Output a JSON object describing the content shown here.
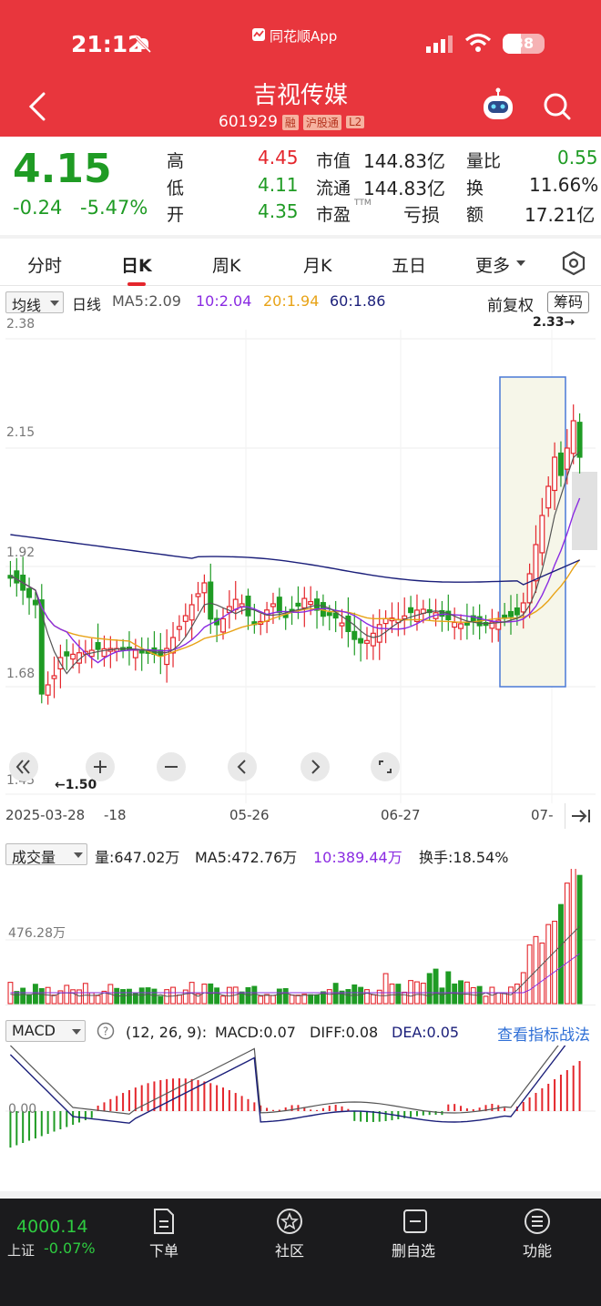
{
  "status_bar": {
    "time": "21:12",
    "app_label": "同花顺App",
    "battery": "38"
  },
  "header": {
    "title": "吉视传媒",
    "code": "601929",
    "tags": [
      "融",
      "沪股通",
      "L2"
    ]
  },
  "quote": {
    "price": "4.15",
    "change": "-0.24",
    "change_pct": "-5.47%",
    "fields": [
      {
        "label": "高",
        "value": "4.45"
      },
      {
        "label": "低",
        "value": "4.11"
      },
      {
        "label": "开",
        "value": "4.35"
      },
      {
        "label": "市值",
        "value": "144.83亿"
      },
      {
        "label": "流通",
        "value": "144.83亿"
      },
      {
        "label": "市盈",
        "sup": "TTM",
        "value": "亏损"
      },
      {
        "label": "量比",
        "value": "0.55"
      },
      {
        "label": "换",
        "value": "11.66%"
      },
      {
        "label": "额",
        "value": "17.21亿"
      }
    ]
  },
  "tabs": [
    "分时",
    "日K",
    "周K",
    "月K",
    "五日",
    "更多"
  ],
  "active_tab": "日K",
  "kline": {
    "indicator_select": "均线",
    "line_type": "日线",
    "ma": [
      {
        "text": "MA5:2.09",
        "color": "#555555"
      },
      {
        "text": "10:2.04",
        "color": "#8a2be2"
      },
      {
        "text": "20:1.94",
        "color": "#e8a317"
      },
      {
        "text": "60:1.86",
        "color": "#1b1f7a"
      }
    ],
    "adjust": "前复权",
    "chips": "筹码",
    "price_labels": [
      "2.38",
      "2.15",
      "1.92",
      "1.68",
      "1.45"
    ],
    "high_label": "2.33→",
    "low_label": "←1.50",
    "dates": [
      "2025-03-28",
      "-18",
      "05-26",
      "06-27",
      "07-"
    ]
  },
  "volume": {
    "select": "成交量",
    "vol": "量:647.02万",
    "ma5": "MA5:472.76万",
    "ma10": "10:389.44万",
    "turnover": "换手:18.54%",
    "axis": "476.28万"
  },
  "macd": {
    "select": "MACD",
    "params": "(12, 26, 9):",
    "macd": "MACD:0.07",
    "diff": "DIFF:0.08",
    "dea": "DEA:0.05",
    "link": "查看指标战法",
    "zero": "0.00"
  },
  "bottom": {
    "index_value": "4000.14",
    "index_name": "上证",
    "index_change": "-0.07%",
    "nav": [
      "下单",
      "社区",
      "删自选",
      "功能"
    ]
  },
  "colors": {
    "header": "#e8363d",
    "up": "#e4262c",
    "down": "#1f9b24",
    "highlight_box": "#4a78d6"
  }
}
